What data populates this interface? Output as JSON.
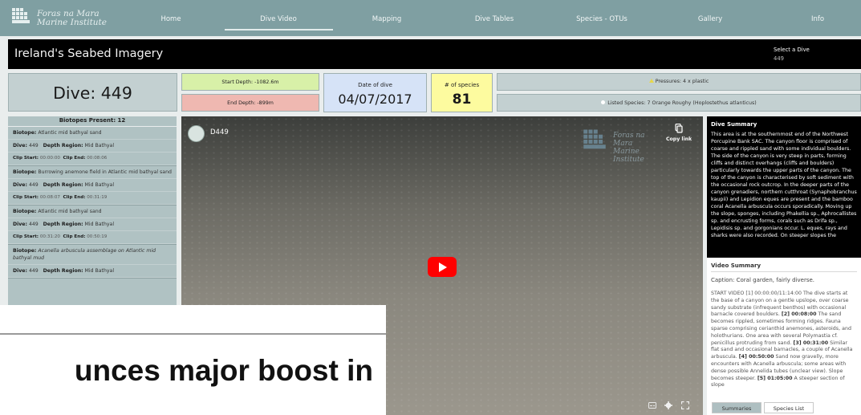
{
  "header": {
    "logo_line1": "Foras na Mara",
    "logo_line2": "Marine Institute",
    "nav": [
      {
        "label": "Home"
      },
      {
        "label": "Dive Video",
        "active": true
      },
      {
        "label": "Mapping"
      },
      {
        "label": "Dive Tables"
      },
      {
        "label": "Species - OTUs"
      },
      {
        "label": "Gallery"
      },
      {
        "label": "Info"
      }
    ]
  },
  "titlebar": {
    "title": "Ireland's Seabed Imagery",
    "select_label": "Select a Dive",
    "select_value": "449"
  },
  "stats": {
    "dive": "Dive: 449",
    "start_depth": "Start Depth: -1082.6m",
    "end_depth": "End Depth: -899m",
    "date_label": "Date of dive",
    "date_value": "04/07/2017",
    "species_label": "# of species",
    "species_value": "81",
    "pressures": "Pressures: 4 x plastic",
    "listed_species": "Listed Species: 7 Orange Roughy (Hoplostethus atlanticus)"
  },
  "biotopes": {
    "header": "Biotopes Present: 12",
    "items": [
      {
        "biotope_label": "Biotope:",
        "biotope": "Atlantic mid bathyal sand",
        "dive_label": "Dive:",
        "dive": "449",
        "region_label": "Depth Region:",
        "region": "Mid Bathyal",
        "clip_start_label": "Clip Start:",
        "clip_start": "00:00:00",
        "clip_end_label": "Clip End:",
        "clip_end": "00:08:06"
      },
      {
        "biotope_label": "Biotope:",
        "biotope": "Burrowing anemone field in Atlantic mid bathyal sand",
        "dive_label": "Dive:",
        "dive": "449",
        "region_label": "Depth Region:",
        "region": "Mid Bathyal",
        "clip_start_label": "Clip Start:",
        "clip_start": "00:08:07",
        "clip_end_label": "Clip End:",
        "clip_end": "00:31:19"
      },
      {
        "biotope_label": "Biotope:",
        "biotope": "Atlantic mid bathyal sand",
        "dive_label": "Dive:",
        "dive": "449",
        "region_label": "Depth Region:",
        "region": "Mid Bathyal",
        "clip_start_label": "Clip Start:",
        "clip_start": "00:31:20",
        "clip_end_label": "Clip End:",
        "clip_end": "00:50:19"
      },
      {
        "biotope_label": "Biotope:",
        "biotope": "Acanella arbuscula assemblage on Atlantic mid bathyal mud",
        "dive_label": "Dive:",
        "dive": "449",
        "region_label": "Depth Region:",
        "region": "Mid Bathyal"
      }
    ]
  },
  "video": {
    "title": "D449",
    "watermark_line1": "Foras na Mara",
    "watermark_line2": "Marine Institute",
    "copy_link": "Copy link"
  },
  "dive_summary": {
    "header": "Dive Summary",
    "body": "This area is at the southernmost end of the Northwest Porcupine Bank SAC. The canyon floor is comprised of coarse and rippled sand with some individual boulders. The side of the canyon is very steep in parts, forming cliffs and distinct overhangs (cliffs and boulders) particularly towards the upper parts of the canyon. The top of the canyon is characterised by soft sediment with the occasional rock outcrop. In the deeper parts of the canyon grenadiers, northern cutthroat (Synaphobranchus kaupii) and Lepidion eques are present and the bamboo coral Acanella arbuscula occurs sporadically. Moving up the slope, sponges, including Phakellia sp., Aphrocallistes sp. and encrusting forms, corals such as Drifa sp., Lepidisis sp. and gorgonians occur. L. eques, rays and sharks were also recorded. On steeper slopes the"
  },
  "video_summary": {
    "header": "Video Summary",
    "caption": "Caption: Coral garden, fairly diverse.",
    "seg1_label": "START VIDEO [1] 00:00:00/11:14:00",
    "seg1_text": "The dive starts at the base of a canyon on a gentle upslope, over coarse sandy substrate (infrequent benthos) with occasional barnacle covered boulders.",
    "seg2_label": "[2] 00:08:00",
    "seg2_text": "The sand becomes rippled, sometimes forming ridges. Fauna sparse comprising cerianthid anemones, asteroids, and holothurians. One area with several Polymastia cf. penicillus protruding from sand.",
    "seg3_label": "[3] 00:31:00",
    "seg3_text": "Similar flat sand and occasional barnacles, a couple of Acanella arbuscula.",
    "seg4_label": "[4] 00:50:00",
    "seg4_text": "Sand now gravelly, more encounters with Acanella arbuscula; some areas with dense possible Annelida tubes (unclear view). Slope becomes steeper.",
    "seg5_label": "[5] 01:05:00",
    "seg5_text": "A steeper section of slope"
  },
  "tabs": {
    "summaries": "Summaries",
    "species_list": "Species List"
  },
  "overlay": {
    "headline": "unces major boost in"
  }
}
